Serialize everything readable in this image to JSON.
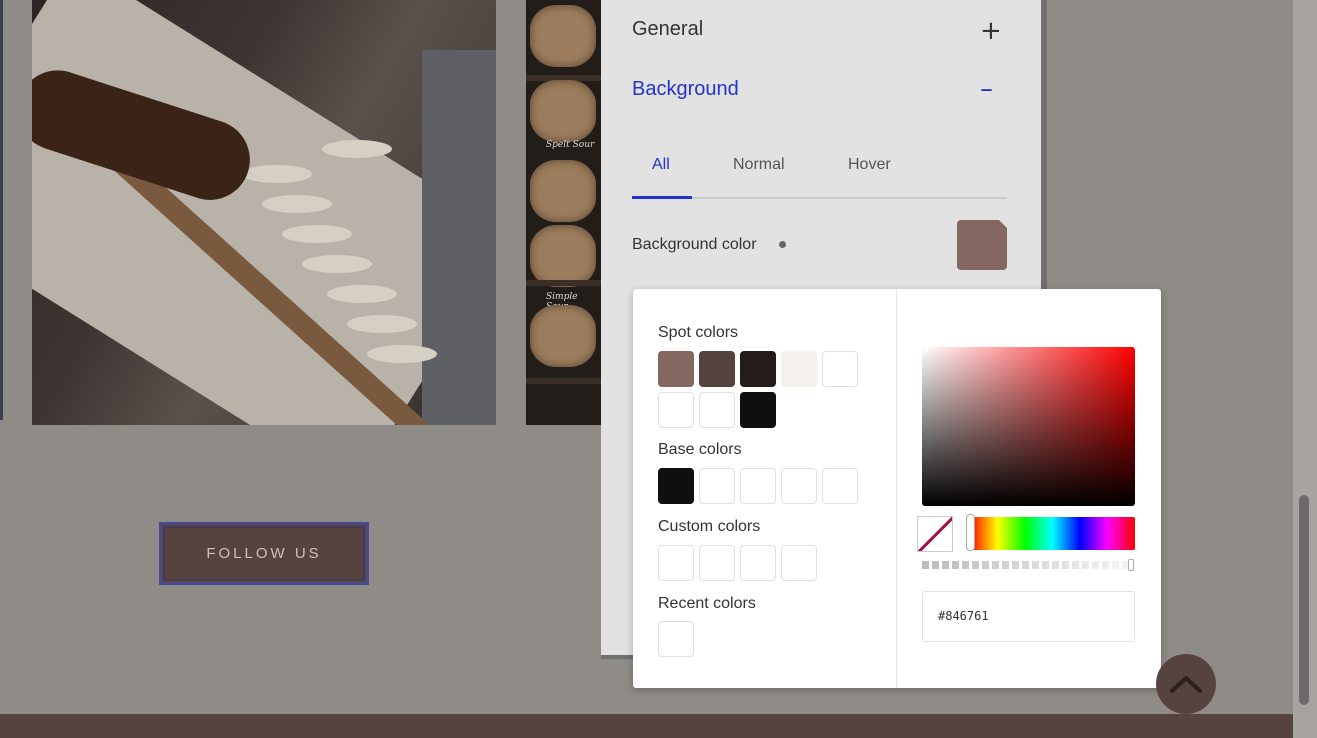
{
  "page": {
    "follow_button": "FOLLOW US",
    "bread_labels": [
      "Spelt Sour",
      "Simple Sour"
    ]
  },
  "panel": {
    "sections": [
      {
        "title": "General",
        "toggle": "+"
      },
      {
        "title": "Background",
        "toggle": "–"
      }
    ],
    "tabs": [
      {
        "label": "All",
        "active": true
      },
      {
        "label": "Normal",
        "active": false
      },
      {
        "label": "Hover",
        "active": false
      }
    ],
    "background_color_label": "Background color",
    "background_color_value": "#846761"
  },
  "picker": {
    "spot_label": "Spot colors",
    "spot_colors": [
      "#846761",
      "#56433f",
      "#251b19",
      "#f4f0ec",
      "#ffffff",
      "#ffffff",
      "#ffffff",
      "#0f0f0f"
    ],
    "base_label": "Base colors",
    "base_colors": [
      "#0f0f0f",
      "#ffffff",
      "#ffffff",
      "#ffffff",
      "#ffffff"
    ],
    "custom_label": "Custom colors",
    "custom_colors": [
      "#ffffff",
      "#ffffff",
      "#ffffff",
      "#ffffff"
    ],
    "recent_label": "Recent colors",
    "recent_colors": [
      "#ffffff"
    ],
    "hex_value": "#846761",
    "hue": "red"
  },
  "icons": {
    "back_to_top": "chevron-up-icon",
    "no_color": "no-color-icon"
  }
}
